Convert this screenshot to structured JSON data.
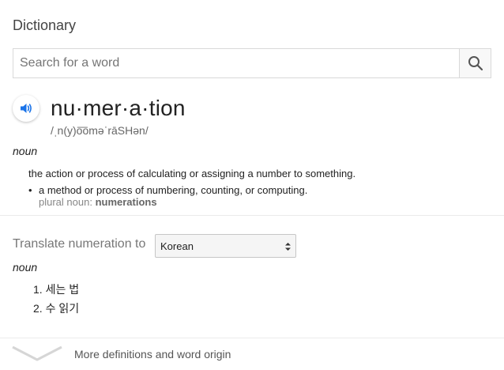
{
  "card": {
    "title": "Dictionary"
  },
  "search": {
    "placeholder": "Search for a word",
    "value": ""
  },
  "entry": {
    "word": "nu·mer·a·tion",
    "phonetic": "/ˌn(y)o͞oməˈrāSHən/",
    "part_of_speech": "noun",
    "definitions": [
      "the action or process of calculating or assigning a number to something.",
      "a method or process of numbering, counting, or computing."
    ],
    "plural_label": "plural noun:",
    "plural_value": "numerations"
  },
  "translate": {
    "label": "Translate numeration to",
    "selected_language": "Korean",
    "part_of_speech": "noun",
    "results": [
      "1. 세는 법",
      "2. 수 읽기"
    ]
  },
  "footer": {
    "more_label": "More definitions and word origin"
  },
  "colors": {
    "accent": "#1a73e8",
    "border": "#d9d9d9",
    "muted": "#878787"
  },
  "icons": {
    "search": "search-icon",
    "speaker": "speaker-icon",
    "chevron": "chevron-down-icon",
    "select": "select-arrows-icon"
  }
}
